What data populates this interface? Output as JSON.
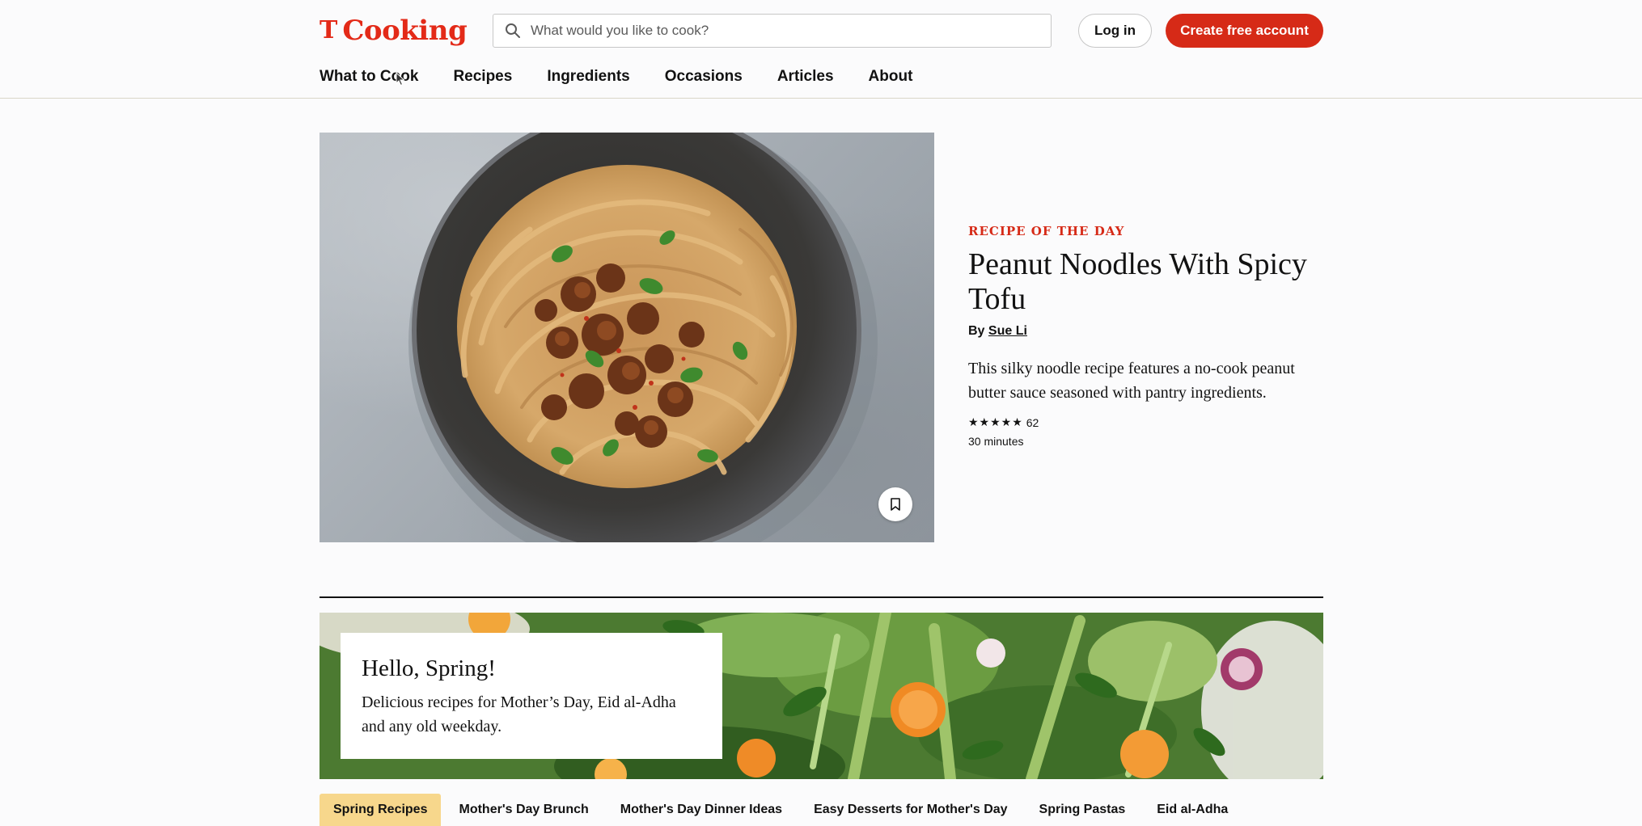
{
  "header": {
    "logo_mark": "T",
    "logo_text": "Cooking",
    "search": {
      "placeholder": "What would you like to cook?"
    },
    "login_label": "Log in",
    "create_account_label": "Create free account"
  },
  "nav": {
    "items": [
      "What to Cook",
      "Recipes",
      "Ingredients",
      "Occasions",
      "Articles",
      "About"
    ]
  },
  "recipe_of_the_day": {
    "label": "RECIPE OF THE DAY",
    "title": "Peanut Noodles With Spicy Tofu",
    "by": "By",
    "author": "Sue Li",
    "description": "This silky noodle recipe features a no-cook peanut butter sauce seasoned with pantry ingredients.",
    "stars": "★★★★★",
    "rating_count": "62",
    "time": "30 minutes"
  },
  "spring": {
    "title": "Hello, Spring!",
    "description": "Delicious recipes for Mother’s Day, Eid al-Adha and any old weekday.",
    "tabs": [
      "Spring Recipes",
      "Mother's Day Brunch",
      "Mother's Day Dinner Ideas",
      "Easy Desserts for Mother's Day",
      "Spring Pastas",
      "Eid al-Adha"
    ],
    "active_tab": "Spring Recipes"
  },
  "colors": {
    "brand_red": "#d62a17",
    "active_tab": "#f7d78c",
    "page_bg": "#fbfbfc"
  },
  "icons": [
    "search-icon",
    "bookmark-icon",
    "mouse-cursor-icon"
  ]
}
